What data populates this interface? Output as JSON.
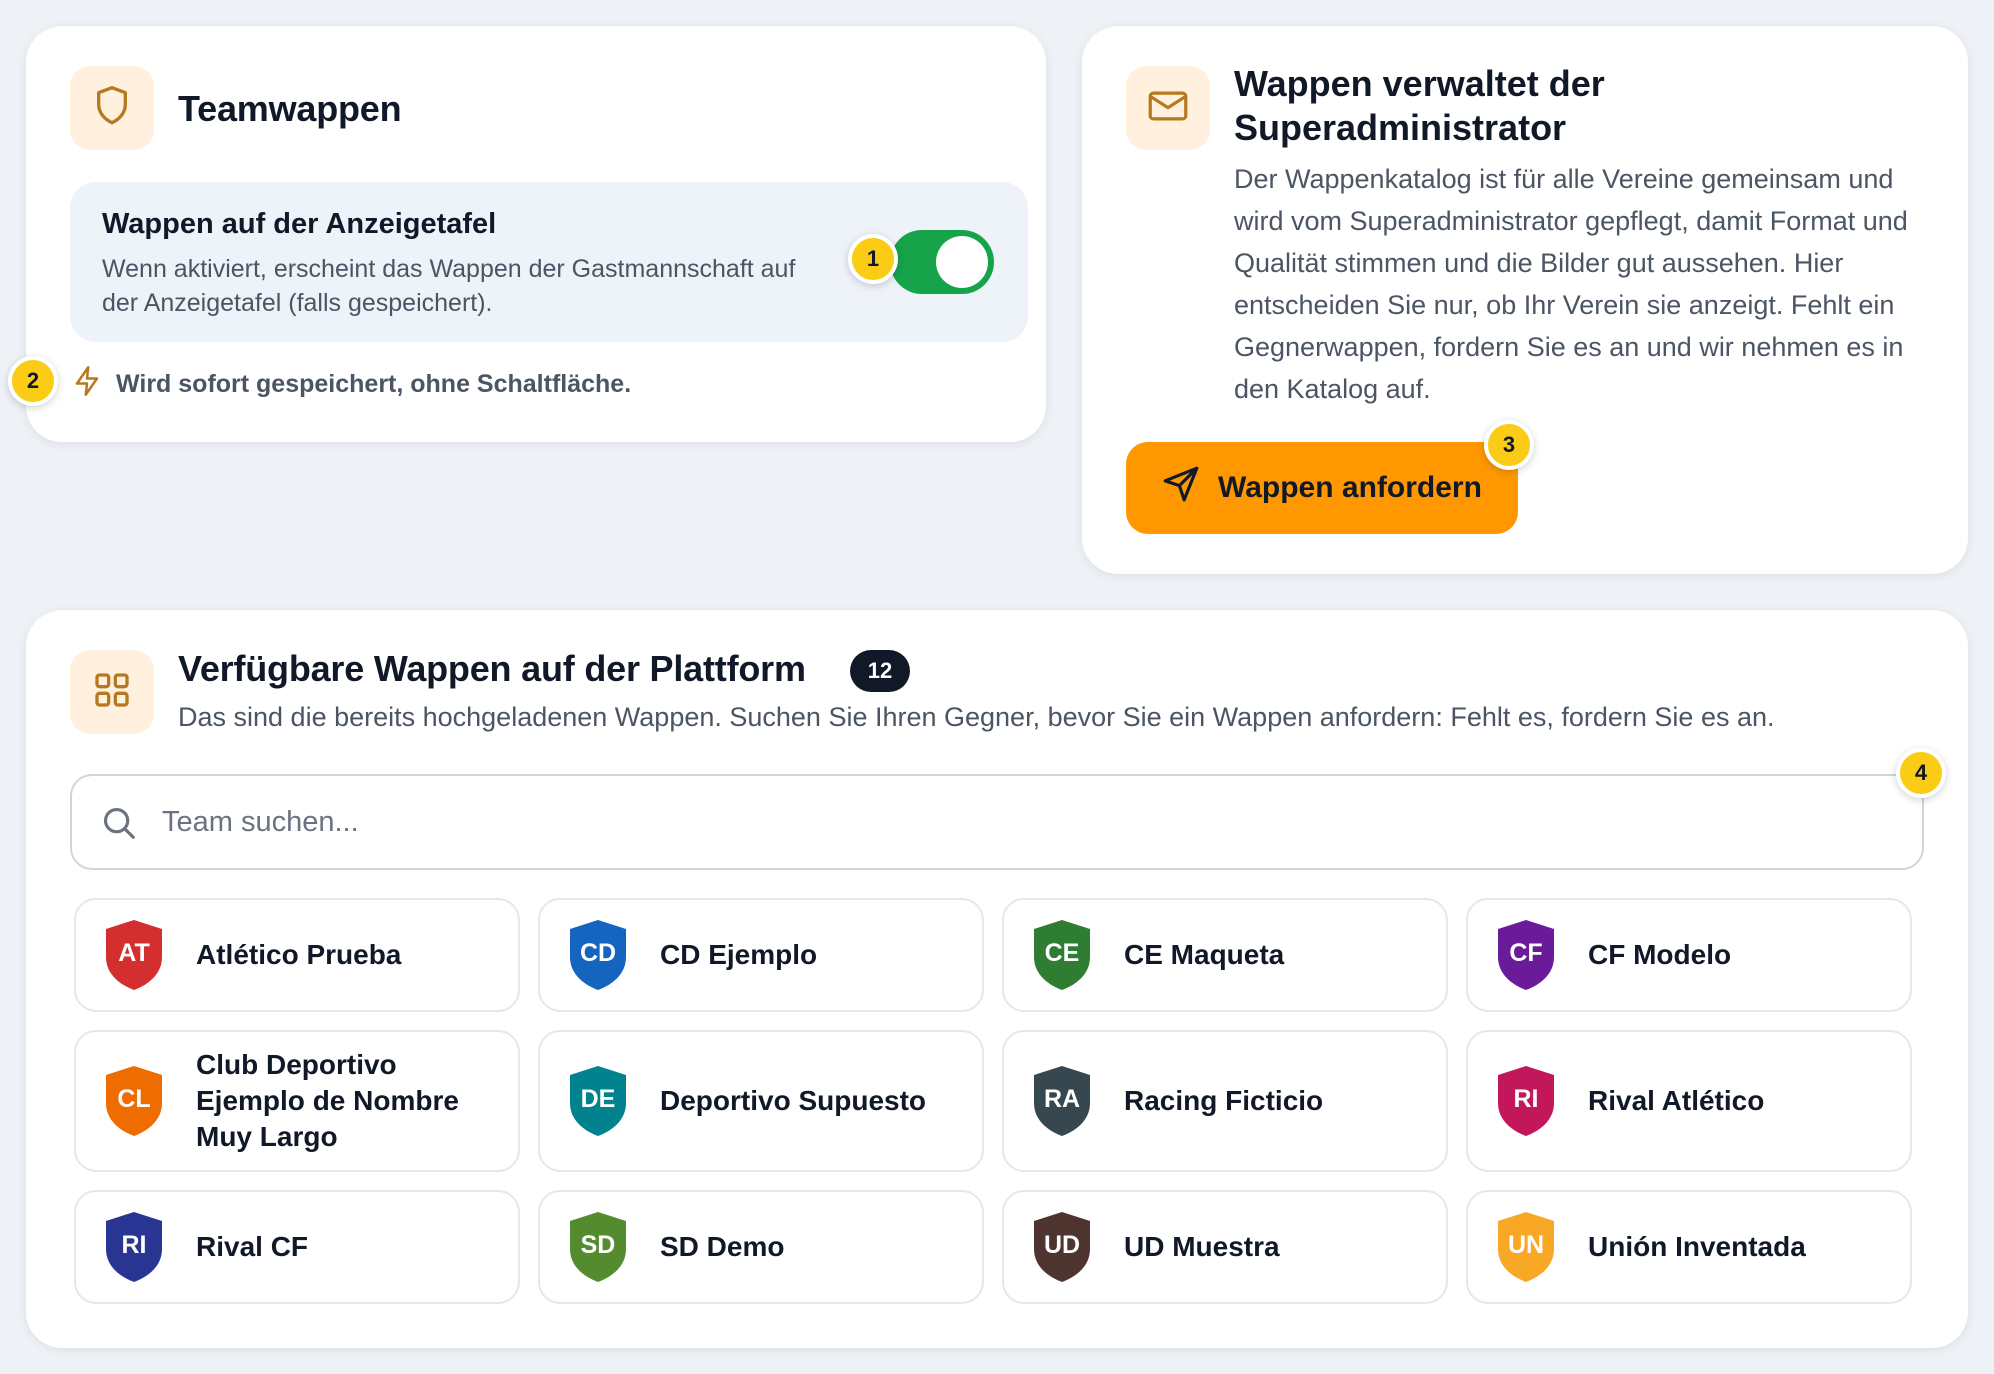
{
  "colors": {
    "accent_orange": "#ff9800",
    "toggle_on": "#16a34a",
    "badge_yellow": "#facc15",
    "icon_tile_bg": "#fff1dd",
    "icon_brown": "#b7791f"
  },
  "crests_card": {
    "icon": "shield-icon",
    "title": "Teamwappen",
    "setting": {
      "title": "Wappen auf der Anzeigetafel",
      "description": "Wenn aktiviert, erscheint das Wappen der Gastmannschaft auf der Anzeigetafel (falls gespeichert).",
      "toggle_on": true
    },
    "hint_icon": "lightning-icon",
    "hint": "Wird sofort gespeichert, ohne Schaltfläche."
  },
  "admin_card": {
    "icon": "mail-icon",
    "title": "Wappen verwaltet der Superadministrator",
    "text": "Der Wappenkatalog ist für alle Vereine gemeinsam und wird vom Superadministrator gepflegt, damit Format und Qualität stimmen und die Bilder gut aussehen. Hier entscheiden Sie nur, ob Ihr Verein sie anzeigt. Fehlt ein Gegnerwappen, fordern Sie es an und wir nehmen es in den Katalog auf.",
    "button_icon": "send-icon",
    "button_label": "Wappen anfordern"
  },
  "available_card": {
    "icon": "grid-icon",
    "title": "Verfügbare Wappen auf der Plattform",
    "count": "12",
    "subtitle": "Das sind die bereits hochgeladenen Wappen. Suchen Sie Ihren Gegner, bevor Sie ein Wappen anfordern: Fehlt es, fordern Sie es an.",
    "search_placeholder": "Team suchen...",
    "search_value": "",
    "teams": [
      {
        "abbr": "AT",
        "name": "Atlético Prueba",
        "color": "#d32f2f"
      },
      {
        "abbr": "CD",
        "name": "CD Ejemplo",
        "color": "#1565c0"
      },
      {
        "abbr": "CE",
        "name": "CE Maqueta",
        "color": "#2e7d32"
      },
      {
        "abbr": "CF",
        "name": "CF Modelo",
        "color": "#6a1b9a"
      },
      {
        "abbr": "CL",
        "name": "Club Deportivo Ejemplo de Nombre Muy Largo",
        "color": "#ef6c00"
      },
      {
        "abbr": "DE",
        "name": "Deportivo Supuesto",
        "color": "#00838f"
      },
      {
        "abbr": "RA",
        "name": "Racing Ficticio",
        "color": "#37474f"
      },
      {
        "abbr": "RI",
        "name": "Rival Atlético",
        "color": "#c2185b"
      },
      {
        "abbr": "RI",
        "name": "Rival CF",
        "color": "#283593"
      },
      {
        "abbr": "SD",
        "name": "SD Demo",
        "color": "#558b2f"
      },
      {
        "abbr": "UD",
        "name": "UD Muestra",
        "color": "#4e342e"
      },
      {
        "abbr": "UN",
        "name": "Unión Inventada",
        "color": "#f9a825"
      }
    ]
  },
  "annotation_badges": [
    "1",
    "2",
    "3",
    "4"
  ]
}
